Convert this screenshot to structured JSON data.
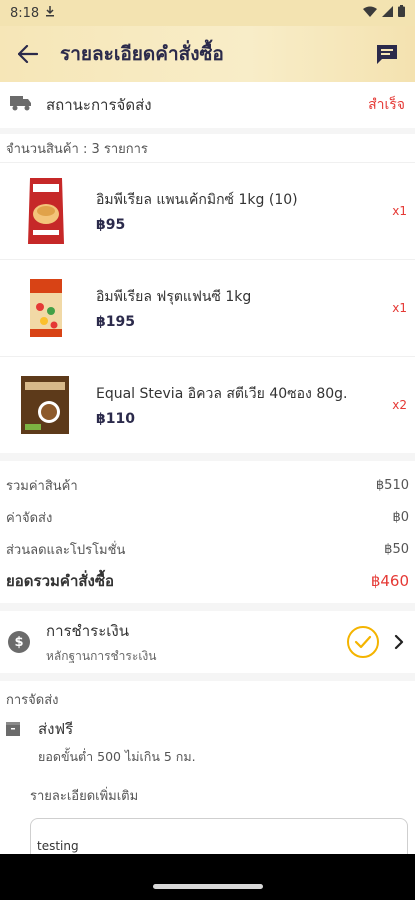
{
  "status_bar": {
    "time": "8:18"
  },
  "header": {
    "title": "รายละเอียดคำสั่งซื้อ",
    "background": "#f6e6b7"
  },
  "delivery": {
    "label": "สถานะการจัดส่ง",
    "status": "สำเร็จ"
  },
  "items_count_label": "จำนวนสินค้า : 3 รายการ",
  "items": [
    {
      "name": "อิมพีเรียล แพนเค้กมิกซ์ 1kg (10)",
      "price": "฿95",
      "qty": "x1"
    },
    {
      "name": "อิมพีเรียล ฟรุตแฟนซี 1kg",
      "price": "฿195",
      "qty": "x1"
    },
    {
      "name": "Equal Stevia อิควล สตีเวีย 40ซอง 80g.",
      "price": "฿110",
      "qty": "x2"
    }
  ],
  "summary": {
    "subtotal_label": "รวมค่าสินค้า",
    "subtotal_value": "฿510",
    "shipping_label": "ค่าจัดส่ง",
    "shipping_value": "฿0",
    "discount_label": "ส่วนลดและโปรโมชั่น",
    "discount_value": "฿50",
    "total_label": "ยอดรวมคำสั่งซื้อ",
    "total_value": "฿460"
  },
  "payment": {
    "title": "การชำระเงิน",
    "subtitle": "หลักฐานการชำระเงิน"
  },
  "shipping": {
    "section_title": "การจัดส่ง",
    "option_title": "ส่งฟรี",
    "option_desc": "ยอดขั้นต่ำ 500 ไม่เกิน 5 กม.",
    "more_label": "รายละเอียดเพิ่มเติม",
    "note_value": "testing"
  },
  "colors": {
    "accent_red": "#e53935",
    "check_yellow": "#f4b400",
    "title_navy": "#2b2a4b"
  }
}
